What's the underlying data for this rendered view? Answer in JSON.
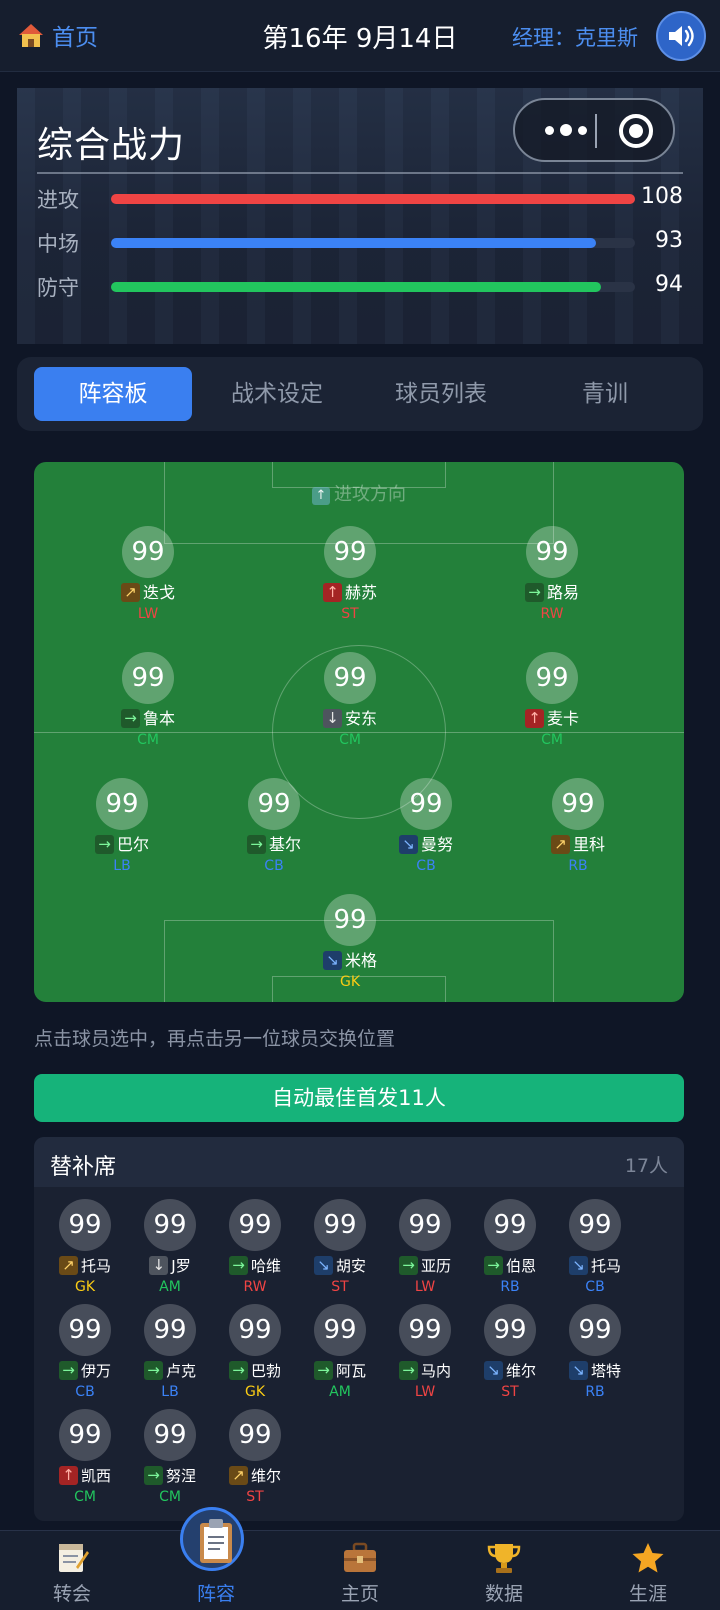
{
  "header": {
    "home_label": "首页",
    "date_title": "第16年 9月14日",
    "manager_label": "经理：克里斯"
  },
  "power": {
    "title": "综合战力",
    "stats": [
      {
        "label": "进攻",
        "value": "108",
        "fill": 1.0,
        "color": "#ef4444"
      },
      {
        "label": "中场",
        "value": "93",
        "fill": 0.925,
        "color": "#3b82f6"
      },
      {
        "label": "防守",
        "value": "94",
        "fill": 0.935,
        "color": "#22c55e"
      }
    ]
  },
  "tabs": [
    "阵容板",
    "战术设定",
    "球员列表",
    "青训"
  ],
  "active_tab": 0,
  "pitch": {
    "attack_direction": "进攻方向",
    "starters": [
      {
        "rating": "99",
        "name": "迭戈",
        "pos": "LW",
        "trend": "up-right"
      },
      {
        "rating": "99",
        "name": "赫苏",
        "pos": "ST",
        "trend": "up"
      },
      {
        "rating": "99",
        "name": "路易",
        "pos": "RW",
        "trend": "right"
      },
      {
        "rating": "99",
        "name": "鲁本",
        "pos": "CM",
        "trend": "right"
      },
      {
        "rating": "99",
        "name": "安东",
        "pos": "CM",
        "trend": "down"
      },
      {
        "rating": "99",
        "name": "麦卡",
        "pos": "CM",
        "trend": "up"
      },
      {
        "rating": "99",
        "name": "巴尔",
        "pos": "LB",
        "trend": "right"
      },
      {
        "rating": "99",
        "name": "基尔",
        "pos": "CB",
        "trend": "right"
      },
      {
        "rating": "99",
        "name": "曼努",
        "pos": "CB",
        "trend": "down-right"
      },
      {
        "rating": "99",
        "name": "里科",
        "pos": "RB",
        "trend": "up-right"
      },
      {
        "rating": "99",
        "name": "米格",
        "pos": "GK",
        "trend": "down-right"
      }
    ]
  },
  "hint": "点击球员选中，再点击另一位球员交换位置",
  "auto_button": "自动最佳首发11人",
  "bench": {
    "title": "替补席",
    "count": "17人",
    "players": [
      {
        "rating": "99",
        "name": "托马",
        "pos": "GK",
        "trend": "up-right"
      },
      {
        "rating": "99",
        "name": "J罗",
        "pos": "AM",
        "trend": "down"
      },
      {
        "rating": "99",
        "name": "哈维",
        "pos": "RW",
        "trend": "right"
      },
      {
        "rating": "99",
        "name": "胡安",
        "pos": "ST",
        "trend": "down-right"
      },
      {
        "rating": "99",
        "name": "亚历",
        "pos": "LW",
        "trend": "right"
      },
      {
        "rating": "99",
        "name": "伯恩",
        "pos": "RB",
        "trend": "right"
      },
      {
        "rating": "99",
        "name": "托马",
        "pos": "CB",
        "trend": "down-right"
      },
      {
        "rating": "99",
        "name": "伊万",
        "pos": "CB",
        "trend": "right"
      },
      {
        "rating": "99",
        "name": "卢克",
        "pos": "LB",
        "trend": "right"
      },
      {
        "rating": "99",
        "name": "巴勃",
        "pos": "GK",
        "trend": "right"
      },
      {
        "rating": "99",
        "name": "阿瓦",
        "pos": "AM",
        "trend": "right"
      },
      {
        "rating": "99",
        "name": "马内",
        "pos": "LW",
        "trend": "right"
      },
      {
        "rating": "99",
        "name": "维尔",
        "pos": "ST",
        "trend": "down-right"
      },
      {
        "rating": "99",
        "name": "塔特",
        "pos": "RB",
        "trend": "down-right"
      },
      {
        "rating": "99",
        "name": "凯西",
        "pos": "CM",
        "trend": "up"
      },
      {
        "rating": "99",
        "name": "努涅",
        "pos": "CM",
        "trend": "right"
      },
      {
        "rating": "99",
        "name": "维尔",
        "pos": "ST",
        "trend": "up-right"
      }
    ]
  },
  "bottom_nav": [
    {
      "label": "转会",
      "icon": "notepad-icon"
    },
    {
      "label": "阵容",
      "icon": "clipboard-icon"
    },
    {
      "label": "主页",
      "icon": "briefcase-icon"
    },
    {
      "label": "数据",
      "icon": "trophy-icon"
    },
    {
      "label": "生涯",
      "icon": "star-icon"
    }
  ],
  "active_nav": 1,
  "colors": {
    "accent": "#3a7ff0",
    "pitch": "#23803a",
    "button_green": "#16b37a",
    "pos_attack": "#ef4444",
    "pos_mid": "#22c55e",
    "pos_def": "#3b82f6",
    "pos_gk": "#facc15"
  }
}
